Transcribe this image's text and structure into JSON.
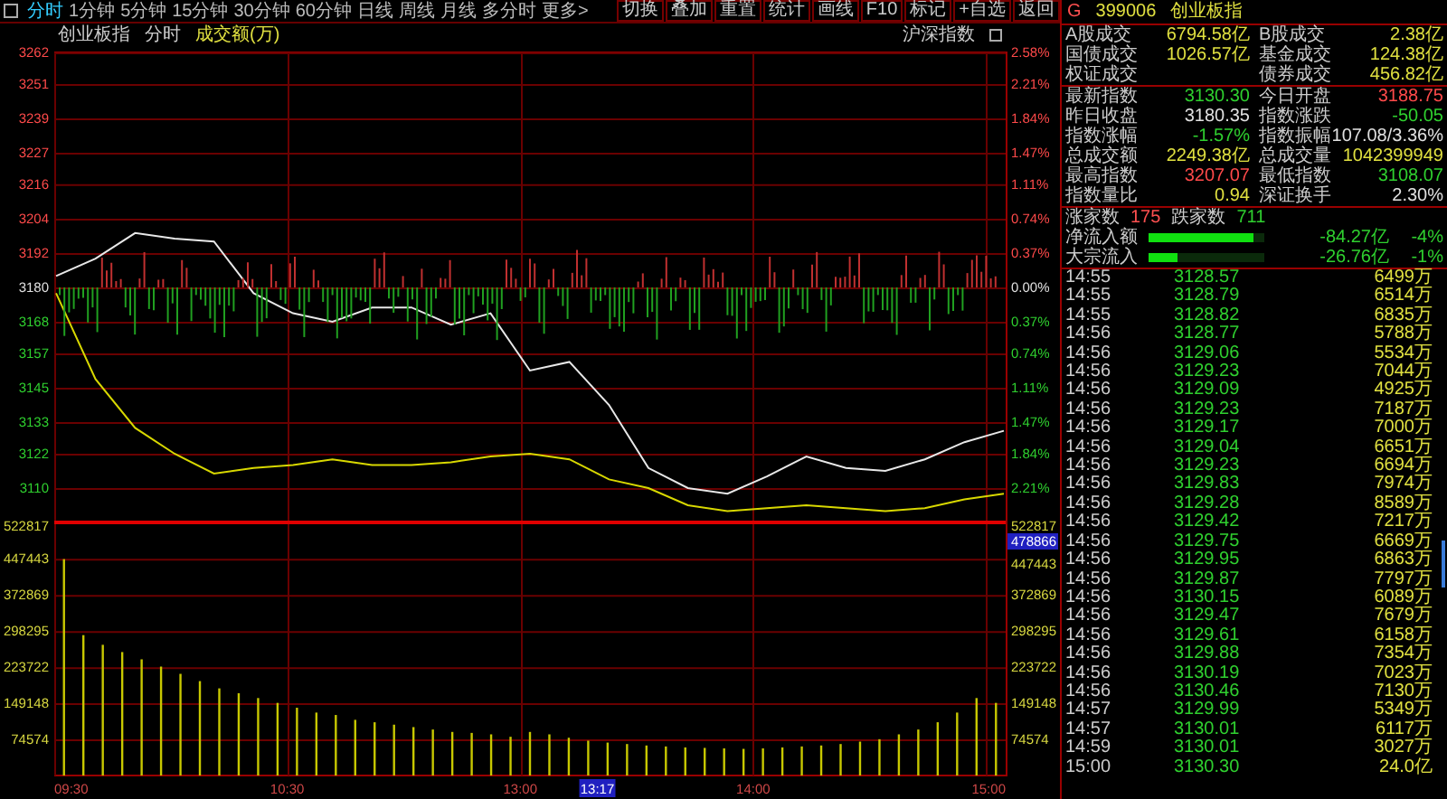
{
  "toolbar": {
    "tabs": [
      {
        "label": "分时",
        "selected": true
      },
      {
        "label": "1分钟",
        "selected": false
      },
      {
        "label": "5分钟",
        "selected": false
      },
      {
        "label": "15分钟",
        "selected": false
      },
      {
        "label": "30分钟",
        "selected": false
      },
      {
        "label": "60分钟",
        "selected": false
      },
      {
        "label": "日线",
        "selected": false
      },
      {
        "label": "周线",
        "selected": false
      },
      {
        "label": "月线",
        "selected": false
      },
      {
        "label": "多分时",
        "selected": false
      },
      {
        "label": "更多>",
        "selected": false
      }
    ],
    "buttons": [
      "切换",
      "叠加",
      "重置",
      "统计",
      "画线",
      "F10",
      "标记",
      "+自选",
      "返回"
    ]
  },
  "chart_header": {
    "index_name": "创业板指",
    "mode": "分时",
    "volume_label": "成交额(万)",
    "overlay_label": "沪深指数",
    "overlay_checked": false
  },
  "price_chart": {
    "chart_data": {
      "type": "line",
      "ylim": [
        3098,
        3262
      ],
      "yticks": [
        3262,
        3251,
        3239,
        3227,
        3216,
        3204,
        3192,
        3180,
        3168,
        3157,
        3145,
        3133,
        3122,
        3110
      ],
      "series": [
        {
          "color": "#e8e8e8",
          "values": [
            3184,
            3190,
            3199,
            3197,
            3196,
            3178,
            3171,
            3168,
            3173,
            3173,
            3167,
            3171,
            3151,
            3154,
            3139,
            3117,
            3110,
            3108,
            3114,
            3121,
            3117,
            3116,
            3120,
            3126,
            3130
          ]
        },
        {
          "color": "#d8d800",
          "values": [
            3178,
            3148,
            3131,
            3122,
            3115,
            3117,
            3118,
            3120,
            3118,
            3118,
            3119,
            3121,
            3122,
            3120,
            3113,
            3110,
            3104,
            3102,
            3103,
            3104,
            3103,
            3102,
            3103,
            3106,
            3108
          ]
        }
      ]
    },
    "right_ticks": [
      {
        "label": "2.58%",
        "kind": "up"
      },
      {
        "label": "2.21%",
        "kind": "up"
      },
      {
        "label": "1.84%",
        "kind": "up"
      },
      {
        "label": "1.47%",
        "kind": "up"
      },
      {
        "label": "1.11%",
        "kind": "up"
      },
      {
        "label": "0.74%",
        "kind": "up"
      },
      {
        "label": "0.37%",
        "kind": "up"
      },
      {
        "label": "0.00%",
        "kind": "flat"
      },
      {
        "label": "0.37%",
        "kind": "down"
      },
      {
        "label": "0.74%",
        "kind": "down"
      },
      {
        "label": "1.11%",
        "kind": "down"
      },
      {
        "label": "1.47%",
        "kind": "down"
      },
      {
        "label": "1.84%",
        "kind": "down"
      },
      {
        "label": "2.21%",
        "kind": "down"
      }
    ]
  },
  "volume_chart": {
    "chart_data": {
      "type": "bar",
      "categories": [
        "09:30",
        null,
        null,
        null,
        null,
        null,
        null,
        null,
        null,
        null,
        null,
        null,
        "10:30",
        null,
        null,
        null,
        null,
        null,
        null,
        null,
        null,
        null,
        null,
        null,
        "13:00",
        null,
        null,
        null,
        null,
        null,
        null,
        null,
        null,
        null,
        null,
        null,
        "14:00",
        null,
        null,
        null,
        null,
        null,
        null,
        null,
        null,
        null,
        null,
        null,
        "15:00"
      ],
      "ylim": [
        0,
        522817
      ],
      "yticks": [
        522817,
        447443,
        372869,
        298295,
        223722,
        149148,
        74574
      ],
      "series": [
        {
          "color": "#c8c800",
          "values": [
            447000,
            290000,
            270000,
            255000,
            240000,
            225000,
            210000,
            195000,
            180000,
            170000,
            160000,
            150000,
            140000,
            130000,
            125000,
            115000,
            110000,
            105000,
            100000,
            95000,
            90000,
            88000,
            85000,
            80000,
            90000,
            85000,
            78000,
            72000,
            68000,
            65000,
            62000,
            60000,
            58000,
            57000,
            56000,
            55000,
            56000,
            58000,
            60000,
            62000,
            65000,
            70000,
            75000,
            85000,
            95000,
            110000,
            130000,
            160000,
            150000
          ]
        }
      ]
    },
    "right_ticks": [
      "522817",
      "447443",
      "372869",
      "298295",
      "223722",
      "149148",
      "74574"
    ],
    "cursor_value": "478866",
    "cursor_time": "13:17"
  },
  "quote": {
    "flag": "G",
    "code": "399006",
    "name": "创业板指"
  },
  "turnover": [
    {
      "label": "A股成交",
      "value": "6794.58亿",
      "color": "#e0e040"
    },
    {
      "label": "B股成交",
      "value": "2.38亿",
      "color": "#e0e040"
    },
    {
      "label": "国债成交",
      "value": "1026.57亿",
      "color": "#e0e040"
    },
    {
      "label": "基金成交",
      "value": "124.38亿",
      "color": "#e0e040"
    },
    {
      "label": "权证成交"
    },
    {
      "label": "债券成交",
      "value": "456.82亿",
      "color": "#e0e040"
    }
  ],
  "index_stats": [
    {
      "label": "最新指数",
      "value": "3130.30",
      "color": "#2fd02f"
    },
    {
      "label": "今日开盘",
      "value": "3188.75",
      "color": "#ff4a4a"
    },
    {
      "label": "昨日收盘",
      "value": "3180.35",
      "color": "#e0e0e0"
    },
    {
      "label": "指数涨跌",
      "value": "-50.05",
      "color": "#2fd02f"
    },
    {
      "label": "指数涨幅",
      "value": "-1.57%",
      "color": "#2fd02f"
    },
    {
      "label": "指数振幅",
      "value": "107.08/3.36%",
      "color": "#e0e0e0"
    },
    {
      "label": "总成交额",
      "value": "2249.38亿",
      "color": "#e0e040"
    },
    {
      "label": "总成交量",
      "value": "1042399949",
      "color": "#e0e040"
    },
    {
      "label": "最高指数",
      "value": "3207.07",
      "color": "#ff4a4a"
    },
    {
      "label": "最低指数",
      "value": "3108.07",
      "color": "#2fd02f"
    },
    {
      "label": "指数量比",
      "value": "0.94",
      "color": "#e0e040"
    },
    {
      "label": "深证换手",
      "value": "2.30%",
      "color": "#e0e0e0"
    }
  ],
  "breadth": {
    "up_label": "涨家数",
    "up_count": "175",
    "down_label": "跌家数",
    "down_count": "711"
  },
  "flows": [
    {
      "label": "净流入额",
      "level": 0.9,
      "amount": "-84.27亿",
      "percent": "-4%"
    },
    {
      "label": "大宗流入",
      "level": 0.25,
      "amount": "-26.76亿",
      "percent": "-1%"
    }
  ],
  "ticks": [
    {
      "time": "14:55",
      "price": "3128.57",
      "volume": "6499万"
    },
    {
      "time": "14:55",
      "price": "3128.79",
      "volume": "6514万"
    },
    {
      "time": "14:55",
      "price": "3128.82",
      "volume": "6835万"
    },
    {
      "time": "14:56",
      "price": "3128.77",
      "volume": "5788万"
    },
    {
      "time": "14:56",
      "price": "3129.06",
      "volume": "5534万"
    },
    {
      "time": "14:56",
      "price": "3129.23",
      "volume": "7044万"
    },
    {
      "time": "14:56",
      "price": "3129.09",
      "volume": "4925万"
    },
    {
      "time": "14:56",
      "price": "3129.23",
      "volume": "7187万"
    },
    {
      "time": "14:56",
      "price": "3129.17",
      "volume": "7000万"
    },
    {
      "time": "14:56",
      "price": "3129.04",
      "volume": "6651万"
    },
    {
      "time": "14:56",
      "price": "3129.23",
      "volume": "6694万"
    },
    {
      "time": "14:56",
      "price": "3129.83",
      "volume": "7974万"
    },
    {
      "time": "14:56",
      "price": "3129.28",
      "volume": "8589万"
    },
    {
      "time": "14:56",
      "price": "3129.42",
      "volume": "7217万"
    },
    {
      "time": "14:56",
      "price": "3129.75",
      "volume": "6669万"
    },
    {
      "time": "14:56",
      "price": "3129.95",
      "volume": "6863万"
    },
    {
      "time": "14:56",
      "price": "3129.87",
      "volume": "7797万"
    },
    {
      "time": "14:56",
      "price": "3130.15",
      "volume": "6089万"
    },
    {
      "time": "14:56",
      "price": "3129.47",
      "volume": "7679万"
    },
    {
      "time": "14:56",
      "price": "3129.61",
      "volume": "6158万"
    },
    {
      "time": "14:56",
      "price": "3129.88",
      "volume": "7354万"
    },
    {
      "time": "14:56",
      "price": "3130.19",
      "volume": "7023万"
    },
    {
      "time": "14:56",
      "price": "3130.46",
      "volume": "7130万"
    },
    {
      "time": "14:57",
      "price": "3129.99",
      "volume": "5349万"
    },
    {
      "time": "14:57",
      "price": "3130.01",
      "volume": "6117万"
    },
    {
      "time": "14:59",
      "price": "3130.01",
      "volume": "3027万"
    },
    {
      "time": "15:00",
      "price": "3130.30",
      "volume": "24.0亿"
    }
  ]
}
